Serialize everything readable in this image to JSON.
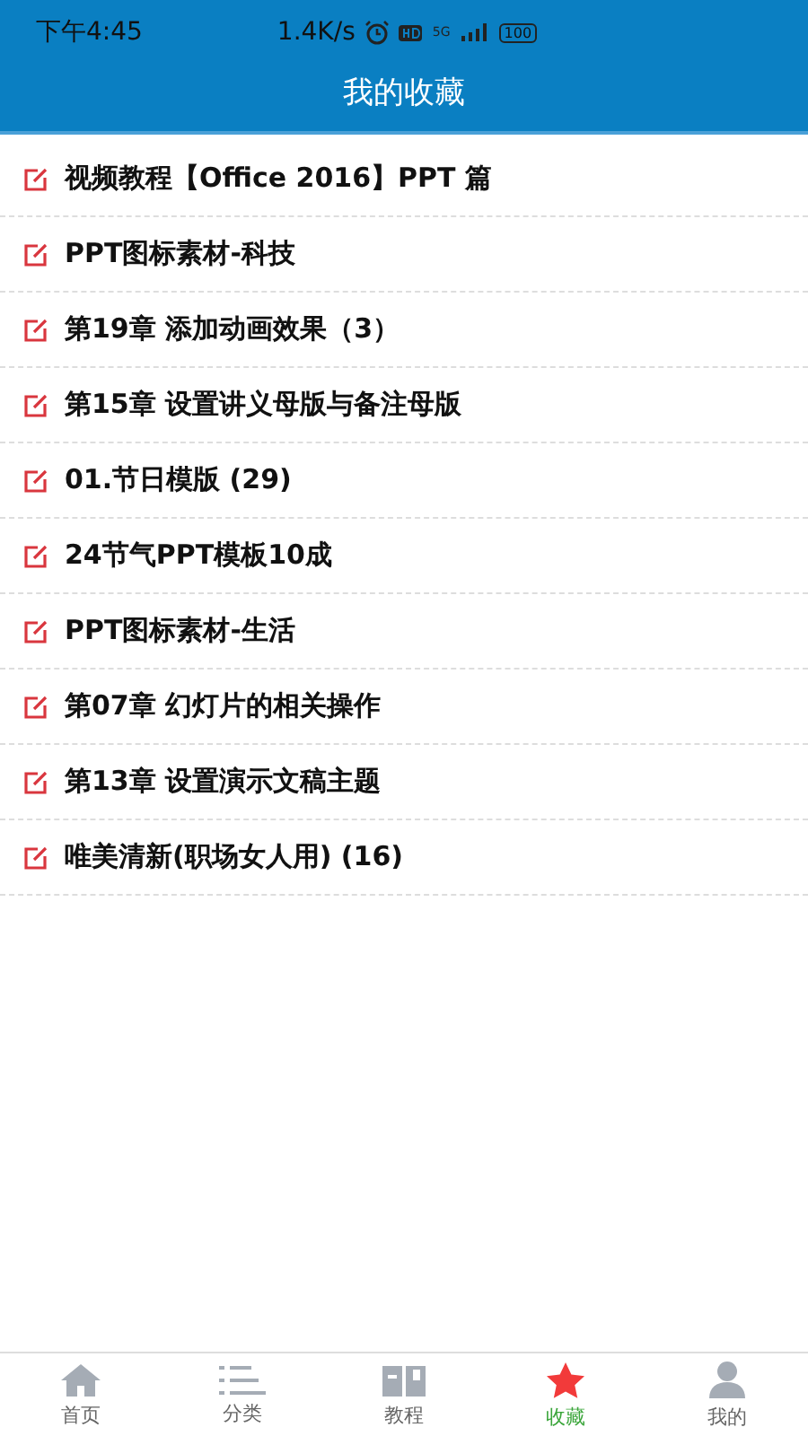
{
  "status_bar": {
    "time": "下午4:45",
    "speed": "1.4K/s",
    "network": "5G",
    "battery": "100"
  },
  "header": {
    "title": "我的收藏"
  },
  "favorites": [
    {
      "title": "视频教程【Office 2016】PPT 篇"
    },
    {
      "title": "PPT图标素材-科技"
    },
    {
      "title": "第19章 添加动画效果（3）"
    },
    {
      "title": "第15章 设置讲义母版与备注母版"
    },
    {
      "title": "01.节日模版 (29)"
    },
    {
      "title": "24节气PPT模板10成"
    },
    {
      "title": "PPT图标素材-生活"
    },
    {
      "title": "第07章 幻灯片的相关操作"
    },
    {
      "title": "第13章 设置演示文稿主题"
    },
    {
      "title": "唯美清新(职场女人用) (16)"
    }
  ],
  "tabs": [
    {
      "label": "首页",
      "kind": "home",
      "selected": false
    },
    {
      "label": "分类",
      "kind": "list",
      "selected": false
    },
    {
      "label": "教程",
      "kind": "book",
      "selected": false
    },
    {
      "label": "收藏",
      "kind": "star",
      "selected": true
    },
    {
      "label": "我的",
      "kind": "person",
      "selected": false
    }
  ]
}
